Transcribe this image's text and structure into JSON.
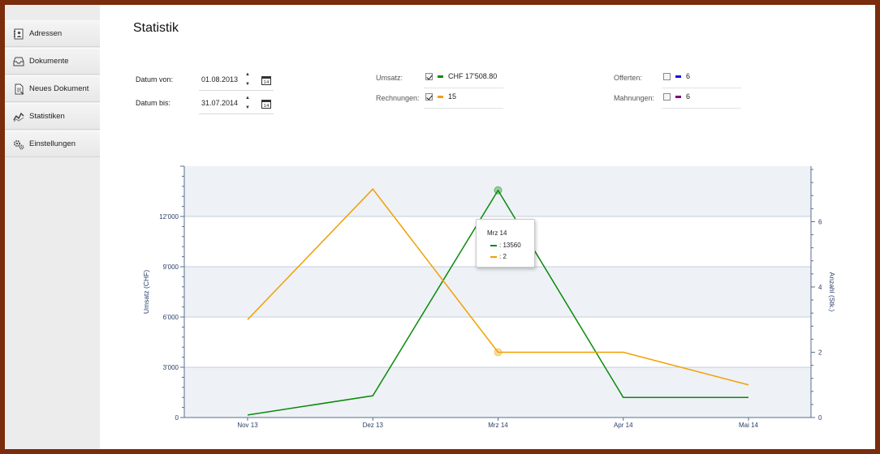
{
  "page": {
    "title": "Statistik"
  },
  "sidebar": {
    "items": [
      {
        "label": "Adressen",
        "icon": "address-book-icon"
      },
      {
        "label": "Dokumente",
        "icon": "inbox-tray-icon"
      },
      {
        "label": "Neues Dokument",
        "icon": "new-document-icon"
      },
      {
        "label": "Statistiken",
        "icon": "line-chart-icon"
      },
      {
        "label": "Einstellungen",
        "icon": "gears-icon"
      }
    ]
  },
  "filters": {
    "from_label": "Datum von:",
    "from_value": "01.08.2013",
    "to_label": "Datum bis:",
    "to_value": "31.07.2014",
    "spin_up": "▲",
    "spin_down": "▼",
    "cal_day": "14"
  },
  "summary": {
    "umsatz": {
      "label": "Umsatz:",
      "value": "CHF 17'508.80",
      "checked": true,
      "color": "#0a8a0a"
    },
    "rechnungen": {
      "label": "Rechnungen:",
      "value": "15",
      "checked": true,
      "color": "#f0a000"
    },
    "offerten": {
      "label": "Offerten:",
      "value": "6",
      "checked": false,
      "color": "#1010e0"
    },
    "mahnungen": {
      "label": "Mahnungen:",
      "value": "6",
      "checked": false,
      "color": "#800080"
    }
  },
  "chart_data": {
    "type": "line",
    "categories": [
      "Nov 13",
      "Dez 13",
      "Mrz 14",
      "Apr 14",
      "Mai 14"
    ],
    "ylabel": "Umsatz (CHF)",
    "y2label": "Anzahl (Stk.)",
    "ylim": [
      0,
      15000
    ],
    "y2lim": [
      0,
      7.7
    ],
    "yticks": [
      0,
      3000,
      6000,
      9000,
      12000
    ],
    "ytick_labels": [
      "0",
      "3'000",
      "6'000",
      "9'000",
      "12'000"
    ],
    "y2ticks": [
      0,
      2,
      4,
      6
    ],
    "y2tick_labels": [
      "0",
      "2",
      "4",
      "6"
    ],
    "grid": true,
    "series": [
      {
        "axis": "left",
        "color": "#0a8a0a",
        "values": [
          150,
          1300,
          13560,
          1200,
          1200
        ]
      },
      {
        "axis": "right",
        "color": "#f0a000",
        "values": [
          3,
          7,
          2,
          2,
          1
        ]
      }
    ],
    "highlight_index": 2,
    "tooltip": {
      "title": "Mrz 14",
      "rows": [
        {
          "text": ": 13560",
          "color": "#0a8a0a"
        },
        {
          "text": ": 2",
          "color": "#f0a000"
        }
      ]
    }
  }
}
